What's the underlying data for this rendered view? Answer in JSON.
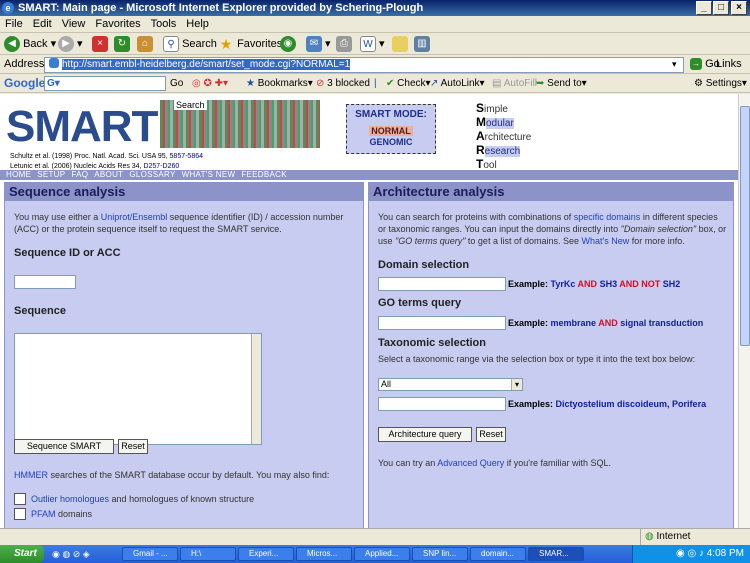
{
  "window": {
    "title": "SMART: Main page - Microsoft Internet Explorer provided by Schering-Plough"
  },
  "menu": [
    "File",
    "Edit",
    "View",
    "Favorites",
    "Tools",
    "Help"
  ],
  "toolbar": {
    "back": "Back",
    "search": "Search",
    "favorites": "Favorites"
  },
  "address": {
    "label": "Address",
    "url": "http://smart.embl-heidelberg.de/smart/set_mode.cgi?NORMAL=1",
    "go": "Go",
    "links": "Links"
  },
  "google_bar": {
    "brand": "Google",
    "go": "Go",
    "bookmarks": "Bookmarks",
    "blocked": "3 blocked",
    "check": "Check",
    "autolink": "AutoLink",
    "autofill": "AutoFill",
    "sendto": "Send to",
    "settings": "Settings"
  },
  "smart": {
    "logo": "SMART",
    "search_tooltip": "Search",
    "cite1_prefix": "Schultz et al. (1998) Proc. Natl. Acad. Sci. USA 95,",
    "cite1_pages": "5857-5864",
    "cite2_prefix": "Letunic et al. (2006) Nucleic Acids Res 34,",
    "cite2_pages": "D257-D260",
    "mode_title": "SMART MODE:",
    "mode_normal": "NORMAL",
    "mode_genomic": "GENOMIC",
    "acronym": [
      [
        "S",
        "imple"
      ],
      [
        "M",
        "odular"
      ],
      [
        "A",
        "rchitecture"
      ],
      [
        "R",
        "esearch"
      ],
      [
        "T",
        "ool"
      ]
    ],
    "nav": [
      "HOME",
      "SETUP",
      "FAQ",
      "ABOUT",
      "GLOSSARY",
      "WHAT'S NEW",
      "FEEDBACK"
    ]
  },
  "seq": {
    "heading": "Sequence analysis",
    "intro_1": "You may use either a ",
    "intro_link": "Uniprot/Ensembl",
    "intro_2": " sequence identifier (ID) / accession number (ACC) or the protein sequence itself to request the SMART service.",
    "id_label": "Sequence ID or ACC",
    "seq_label": "Sequence",
    "submit": "Sequence SMART",
    "reset": "Reset",
    "hmmer_link": "HMMER",
    "hmmer_text": " searches of the SMART database occur by default. You may also find:",
    "opt1_link": "Outlier homologues",
    "opt1_text": " and homologues of known structure",
    "opt2_link": "PFAM",
    "opt2_text": " domains"
  },
  "arch": {
    "heading": "Architecture analysis",
    "intro_1": "You can search for proteins with combinations of ",
    "intro_link1": "specific domains",
    "intro_2": " in different species or taxonomic ranges. You can input the domains directly into ",
    "intro_it1": "\"Domain selection\"",
    "intro_3": " box, or use ",
    "intro_it2": "\"GO terms query\"",
    "intro_4": " to get a list of domains. See ",
    "intro_link2": "What's New",
    "intro_5": " for more info.",
    "domain_label": "Domain selection",
    "domain_example": "Example: ",
    "domain_ex1": "TyrKc",
    "and1": "AND",
    "domain_ex2": "SH3",
    "and2": "AND NOT",
    "domain_ex3": "SH2",
    "go_label": "GO terms query",
    "go_example": "Example: ",
    "go_ex1": "membrane",
    "go_and": "AND",
    "go_ex2": "signal transduction",
    "tax_label": "Taxonomic selection",
    "tax_text": "Select a taxonomic range via the selection box or type it into the text box below:",
    "tax_select": "All",
    "tax_example": "Examples: ",
    "tax_ex": "Dictyostelium discoideum, Porifera",
    "submit": "Architecture query",
    "reset": "Reset",
    "advanced_1": "You can try an ",
    "advanced_link": "Advanced Query",
    "advanced_2": " if you're familiar with SQL."
  },
  "status": {
    "zone": "Internet"
  },
  "taskbar": {
    "start": "Start",
    "tasks": [
      "Gmail - ...",
      "H:\\",
      "Experi...",
      "Micros...",
      "Applied...",
      "SNP lin...",
      "domain...",
      "SMAR..."
    ],
    "time": "4:08 PM"
  }
}
